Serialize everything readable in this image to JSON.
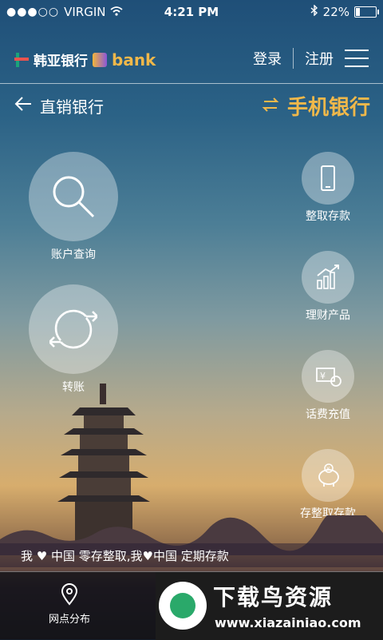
{
  "status": {
    "carrier": "VIRGIN",
    "time": "4:21 PM",
    "battery": "22%",
    "battery_level": 0.22
  },
  "header": {
    "brand": "韩亚银行",
    "brand_sub": "bank",
    "login": "登录",
    "register": "注册"
  },
  "subnav": {
    "back_label": "直销银行",
    "mobile_label": "手机银行"
  },
  "main_actions": [
    {
      "label": "账户查询",
      "icon": "search-icon"
    },
    {
      "label": "转账",
      "icon": "transfer-icon"
    }
  ],
  "side_actions": [
    {
      "label": "整取存款",
      "icon": "phone-icon"
    },
    {
      "label": "理财产品",
      "icon": "chart-icon"
    },
    {
      "label": "话费充值",
      "icon": "bill-icon"
    },
    {
      "label": "存整取存款",
      "icon": "piggybank-icon"
    }
  ],
  "marquee": "我 ♥ 中国 零存整取,我♥中国 定期存款",
  "bottom": {
    "branch_label": "网点分布"
  },
  "watermark": {
    "title": "下载鸟资源",
    "url": "www.xiazainiao.com"
  }
}
